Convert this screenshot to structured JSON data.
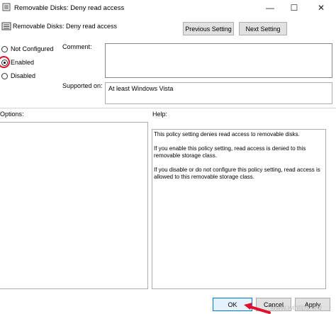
{
  "window": {
    "title": "Removable Disks: Deny read access",
    "minimize_glyph": "—",
    "maximize_glyph": "☐",
    "close_glyph": "✕"
  },
  "header": {
    "policy_name": "Removable Disks: Deny read access",
    "previous_label": "Previous Setting",
    "next_label": "Next Setting"
  },
  "state": {
    "options": [
      {
        "label": "Not Configured",
        "checked": false
      },
      {
        "label": "Enabled",
        "checked": true
      },
      {
        "label": "Disabled",
        "checked": false
      }
    ]
  },
  "comment": {
    "label": "Comment:",
    "value": ""
  },
  "supported": {
    "label": "Supported on:",
    "value": "At least Windows Vista"
  },
  "options_panel": {
    "label": "Options:"
  },
  "help": {
    "label": "Help:",
    "paragraphs": [
      "This policy setting denies read access to removable disks.",
      "If you enable this policy setting, read access is denied to this removable storage class.",
      "If you disable or do not configure this policy setting, read access is allowed to this removable storage class."
    ]
  },
  "footer": {
    "ok_label": "OK",
    "cancel_label": "Cancel",
    "apply_label": "Apply"
  },
  "watermark": "www.wintips.org",
  "colors": {
    "highlight_red": "#e0102b",
    "button_face": "#e1e1e1",
    "ok_border": "#0078d7"
  }
}
